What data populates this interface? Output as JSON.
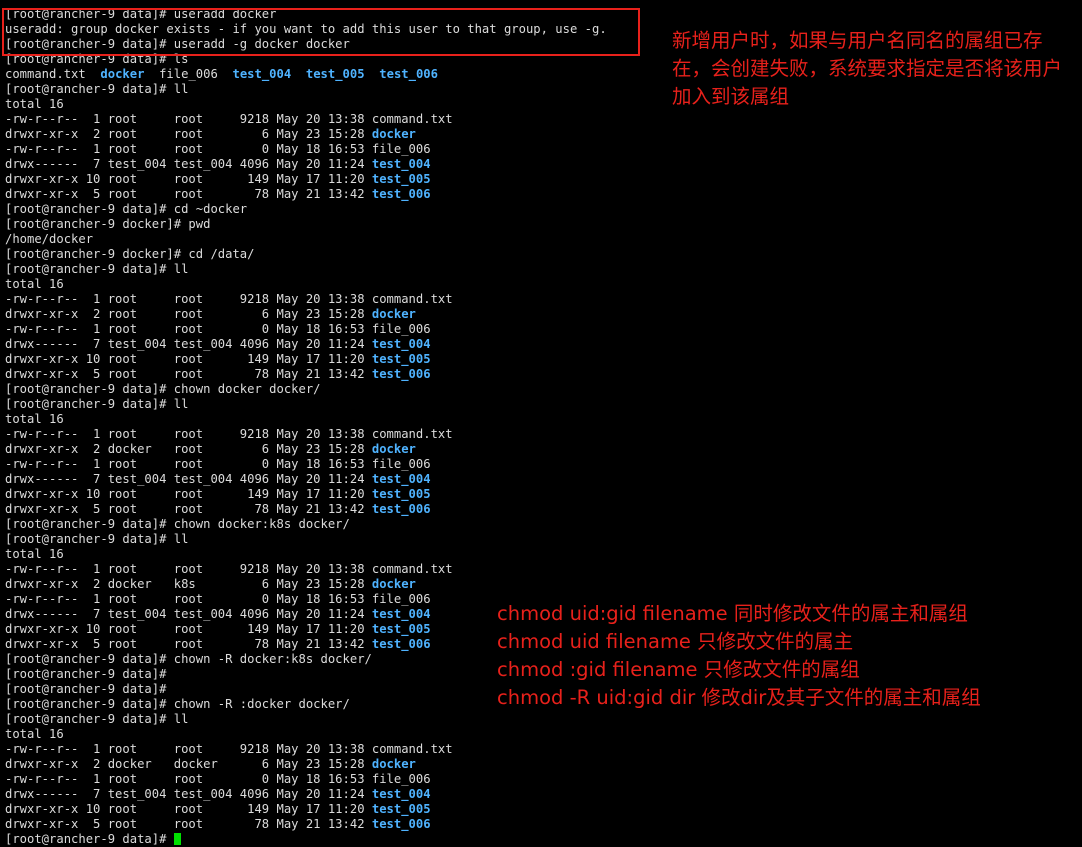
{
  "colors": {
    "background": "#000000",
    "text": "#dcdcdc",
    "directory": "#4fb3ff",
    "annotation": "#e8211b",
    "cursor": "#00e000"
  },
  "terminal": {
    "lines": [
      [
        {
          "t": "[root@rancher-9 data]# useradd docker"
        }
      ],
      [
        {
          "t": "useradd: group docker exists - if you want to add this user to that group, use -g."
        }
      ],
      [
        {
          "t": "[root@rancher-9 data]# useradd -g docker docker"
        }
      ],
      [
        {
          "t": "[root@rancher-9 data]# ls"
        }
      ],
      [
        {
          "t": "command.txt  "
        },
        {
          "t": "docker",
          "c": "dir"
        },
        {
          "t": "  file_006  "
        },
        {
          "t": "test_004",
          "c": "dir"
        },
        {
          "t": "  "
        },
        {
          "t": "test_005",
          "c": "dir"
        },
        {
          "t": "  "
        },
        {
          "t": "test_006",
          "c": "dir"
        }
      ],
      [
        {
          "t": "[root@rancher-9 data]# ll"
        }
      ],
      [
        {
          "t": "total 16"
        }
      ],
      [
        {
          "t": "-rw-r--r--  1 root     root     9218 May 20 13:38 command.txt"
        }
      ],
      [
        {
          "t": "drwxr-xr-x  2 root     root        6 May 23 15:28 "
        },
        {
          "t": "docker",
          "c": "dir"
        }
      ],
      [
        {
          "t": "-rw-r--r--  1 root     root        0 May 18 16:53 file_006"
        }
      ],
      [
        {
          "t": "drwx------  7 test_004 test_004 4096 May 20 11:24 "
        },
        {
          "t": "test_004",
          "c": "dir"
        }
      ],
      [
        {
          "t": "drwxr-xr-x 10 root     root      149 May 17 11:20 "
        },
        {
          "t": "test_005",
          "c": "dir"
        }
      ],
      [
        {
          "t": "drwxr-xr-x  5 root     root       78 May 21 13:42 "
        },
        {
          "t": "test_006",
          "c": "dir"
        }
      ],
      [
        {
          "t": "[root@rancher-9 data]# cd ~docker"
        }
      ],
      [
        {
          "t": "[root@rancher-9 docker]# pwd"
        }
      ],
      [
        {
          "t": "/home/docker"
        }
      ],
      [
        {
          "t": "[root@rancher-9 docker]# cd /data/"
        }
      ],
      [
        {
          "t": "[root@rancher-9 data]# ll"
        }
      ],
      [
        {
          "t": "total 16"
        }
      ],
      [
        {
          "t": "-rw-r--r--  1 root     root     9218 May 20 13:38 command.txt"
        }
      ],
      [
        {
          "t": "drwxr-xr-x  2 root     root        6 May 23 15:28 "
        },
        {
          "t": "docker",
          "c": "dir"
        }
      ],
      [
        {
          "t": "-rw-r--r--  1 root     root        0 May 18 16:53 file_006"
        }
      ],
      [
        {
          "t": "drwx------  7 test_004 test_004 4096 May 20 11:24 "
        },
        {
          "t": "test_004",
          "c": "dir"
        }
      ],
      [
        {
          "t": "drwxr-xr-x 10 root     root      149 May 17 11:20 "
        },
        {
          "t": "test_005",
          "c": "dir"
        }
      ],
      [
        {
          "t": "drwxr-xr-x  5 root     root       78 May 21 13:42 "
        },
        {
          "t": "test_006",
          "c": "dir"
        }
      ],
      [
        {
          "t": "[root@rancher-9 data]# chown docker docker/"
        }
      ],
      [
        {
          "t": "[root@rancher-9 data]# ll"
        }
      ],
      [
        {
          "t": "total 16"
        }
      ],
      [
        {
          "t": "-rw-r--r--  1 root     root     9218 May 20 13:38 command.txt"
        }
      ],
      [
        {
          "t": "drwxr-xr-x  2 docker   root        6 May 23 15:28 "
        },
        {
          "t": "docker",
          "c": "dir"
        }
      ],
      [
        {
          "t": "-rw-r--r--  1 root     root        0 May 18 16:53 file_006"
        }
      ],
      [
        {
          "t": "drwx------  7 test_004 test_004 4096 May 20 11:24 "
        },
        {
          "t": "test_004",
          "c": "dir"
        }
      ],
      [
        {
          "t": "drwxr-xr-x 10 root     root      149 May 17 11:20 "
        },
        {
          "t": "test_005",
          "c": "dir"
        }
      ],
      [
        {
          "t": "drwxr-xr-x  5 root     root       78 May 21 13:42 "
        },
        {
          "t": "test_006",
          "c": "dir"
        }
      ],
      [
        {
          "t": "[root@rancher-9 data]# chown docker:k8s docker/"
        }
      ],
      [
        {
          "t": "[root@rancher-9 data]# ll"
        }
      ],
      [
        {
          "t": "total 16"
        }
      ],
      [
        {
          "t": "-rw-r--r--  1 root     root     9218 May 20 13:38 command.txt"
        }
      ],
      [
        {
          "t": "drwxr-xr-x  2 docker   k8s         6 May 23 15:28 "
        },
        {
          "t": "docker",
          "c": "dir"
        }
      ],
      [
        {
          "t": "-rw-r--r--  1 root     root        0 May 18 16:53 file_006"
        }
      ],
      [
        {
          "t": "drwx------  7 test_004 test_004 4096 May 20 11:24 "
        },
        {
          "t": "test_004",
          "c": "dir"
        }
      ],
      [
        {
          "t": "drwxr-xr-x 10 root     root      149 May 17 11:20 "
        },
        {
          "t": "test_005",
          "c": "dir"
        }
      ],
      [
        {
          "t": "drwxr-xr-x  5 root     root       78 May 21 13:42 "
        },
        {
          "t": "test_006",
          "c": "dir"
        }
      ],
      [
        {
          "t": "[root@rancher-9 data]# chown -R docker:k8s docker/"
        }
      ],
      [
        {
          "t": "[root@rancher-9 data]#"
        }
      ],
      [
        {
          "t": "[root@rancher-9 data]#"
        }
      ],
      [
        {
          "t": "[root@rancher-9 data]# chown -R :docker docker/"
        }
      ],
      [
        {
          "t": "[root@rancher-9 data]# ll"
        }
      ],
      [
        {
          "t": "total 16"
        }
      ],
      [
        {
          "t": "-rw-r--r--  1 root     root     9218 May 20 13:38 command.txt"
        }
      ],
      [
        {
          "t": "drwxr-xr-x  2 docker   docker      6 May 23 15:28 "
        },
        {
          "t": "docker",
          "c": "dir"
        }
      ],
      [
        {
          "t": "-rw-r--r--  1 root     root        0 May 18 16:53 file_006"
        }
      ],
      [
        {
          "t": "drwx------  7 test_004 test_004 4096 May 20 11:24 "
        },
        {
          "t": "test_004",
          "c": "dir"
        }
      ],
      [
        {
          "t": "drwxr-xr-x 10 root     root      149 May 17 11:20 "
        },
        {
          "t": "test_005",
          "c": "dir"
        }
      ],
      [
        {
          "t": "drwxr-xr-x  5 root     root       78 May 21 13:42 "
        },
        {
          "t": "test_006",
          "c": "dir"
        }
      ],
      [
        {
          "t": "[root@rancher-9 data]# "
        },
        {
          "cursor": true
        }
      ]
    ]
  },
  "annotations": {
    "top": "新增用户时，如果与用户名同名的属组已存在，会创建失败，系统要求指定是否将该用户加入到该属组",
    "bottom": [
      "chmod uid:gid filename 同时修改文件的属主和属组",
      "chmod uid filename 只修改文件的属主",
      "chmod :gid filename 只修改文件的属组",
      "chmod -R uid:gid dir 修改dir及其子文件的属主和属组"
    ]
  }
}
